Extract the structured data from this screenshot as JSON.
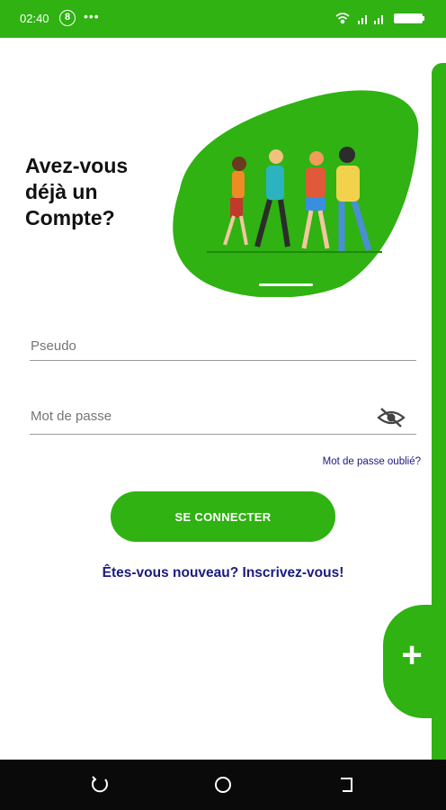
{
  "status_bar": {
    "time": "02:40",
    "badge": "8",
    "dots": "•••",
    "icons": [
      "wifi-icon",
      "signal-icon",
      "signal-icon",
      "battery-icon"
    ]
  },
  "header": {
    "title": "Avez-vous déjà un Compte?"
  },
  "form": {
    "pseudo_placeholder": "Pseudo",
    "password_placeholder": "Mot de passe",
    "forgot_password": "Mot de passe oublié?",
    "login_button": "SE CONNECTER",
    "signup_link": "Êtes-vous nouveau? Inscrivez-vous!"
  },
  "fab": {
    "icon": "plus-icon",
    "label": "+"
  },
  "nav": {
    "icons": [
      "recent-apps-icon",
      "home-icon",
      "back-icon"
    ]
  },
  "colors": {
    "primary": "#2fb212",
    "link": "#1a1a80",
    "status": "#2fb212"
  }
}
